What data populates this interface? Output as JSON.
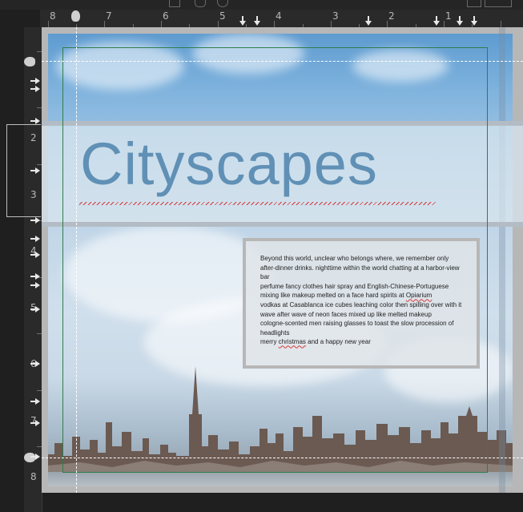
{
  "ruler": {
    "horizontal_labels": [
      "8",
      "7",
      "6",
      "5",
      "4",
      "3",
      "2",
      "1"
    ],
    "vertical_labels": [
      "2",
      "3",
      "4",
      "5",
      "6",
      "7",
      "8"
    ]
  },
  "document": {
    "title": "Cityscapes",
    "body_lines": [
      "Beyond this world,  unclear who belongs where,  we remember only",
      "after-dinner drinks. nighttime  within the world chatting at a harbor-view",
      "bar",
      "perfume fancy clothes hair spray and English-Chinese-Portuguese",
      "mixing like makeup melted on a face hard spirits at ",
      "vodkas at Casablanca ice cubes leaching color then spilling over with it",
      "wave after wave of neon faces mixed up like melted makeup",
      " cologne-scented men raising glasses to toast the slow procession of",
      "headlights",
      "merry ",
      " and a happy new year"
    ],
    "misspelled_1": "Opiarium",
    "misspelled_2": "christmas"
  },
  "colors": {
    "title": "#6090b5",
    "spellcheck": "#d43a3a",
    "margin_guide": "#2f7d4b"
  }
}
